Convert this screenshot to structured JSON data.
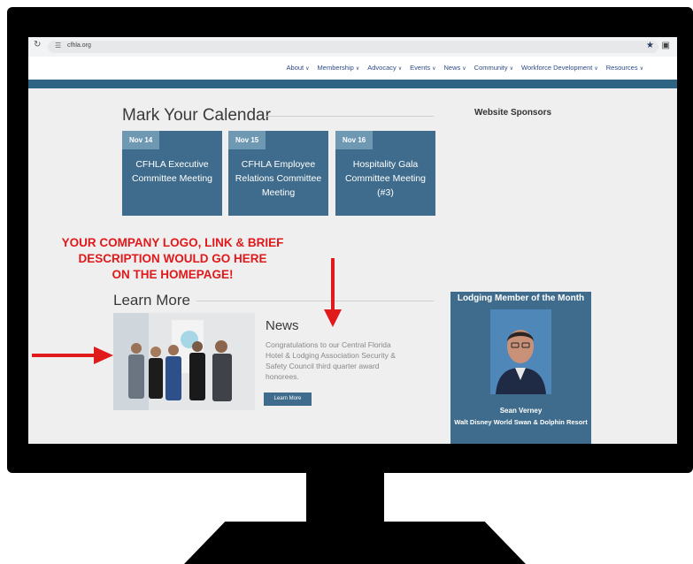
{
  "browser": {
    "url": "cfhla.org",
    "icons": [
      "reload-icon",
      "site-info-icon",
      "bookmark-star-icon",
      "extensions-icon"
    ]
  },
  "nav": {
    "items": [
      {
        "label": "About"
      },
      {
        "label": "Membership"
      },
      {
        "label": "Advocacy"
      },
      {
        "label": "Events"
      },
      {
        "label": "News"
      },
      {
        "label": "Community"
      },
      {
        "label": "Workforce Development"
      },
      {
        "label": "Resources"
      }
    ]
  },
  "calendar": {
    "heading": "Mark Your Calendar",
    "events": [
      {
        "date": "Nov 14",
        "title": "CFHLA Executive Committee Meeting"
      },
      {
        "date": "Nov 15",
        "title": "CFHLA Employee Relations Committee Meeting"
      },
      {
        "date": "Nov 16",
        "title": "Hospitality Gala Committee Meeting (#3)"
      }
    ]
  },
  "sponsors": {
    "heading": "Website Sponsors"
  },
  "learn_more": {
    "heading": "Learn More",
    "news_title": "News",
    "news_text": "Congratulations to our Central Florida Hotel & Lodging Association Security & Safety Council third quarter award honorees.",
    "button": "Learn More"
  },
  "lodging_member": {
    "heading": "Lodging Member of the Month",
    "name": "Sean Verney",
    "affiliation": "Walt Disney World Swan & Dolphin Resort"
  },
  "promo": {
    "line1": "YOUR COMPANY LOGO, LINK & BRIEF",
    "line2": "DESCRIPTION WOULD GO HERE",
    "line3": "ON THE HOMEPAGE!"
  },
  "colors": {
    "accent_blue": "#3f6c8c",
    "date_tab": "#6f98b3",
    "nav_link": "#2c4a87",
    "promo_red": "#e0191b"
  }
}
